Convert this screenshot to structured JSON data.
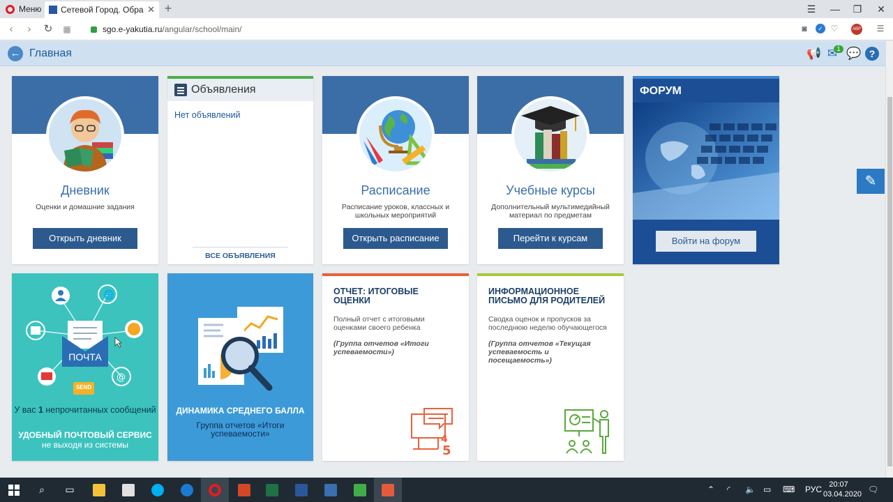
{
  "browser": {
    "menu_label": "Меню",
    "tab_title": "Сетевой Город. Образова",
    "url_host": "sgo.e-yakutia.ru",
    "url_path": "/angular/school/main/"
  },
  "header": {
    "title": "Главная",
    "messages_badge": "1"
  },
  "cards": {
    "diary": {
      "title": "Дневник",
      "desc": "Оценки и домашние задания",
      "button": "Открыть дневник"
    },
    "announcements": {
      "title": "Объявления",
      "empty": "Нет объявлений",
      "all_link": "ВСЕ ОБЪЯВЛЕНИЯ"
    },
    "schedule": {
      "title": "Расписание",
      "desc": "Расписание уроков, классных и школьных мероприятий",
      "button": "Открыть расписание"
    },
    "courses": {
      "title": "Учебные курсы",
      "desc": "Дополнительный мультимедийный материал по предметам",
      "button": "Перейти к курсам"
    },
    "forum": {
      "title": "ФОРУМ",
      "button": "Войти на форум"
    },
    "mail": {
      "envelope_label": "ПОЧТА",
      "send_label": "SEND",
      "unread_prefix": "У вас",
      "unread_count": "1",
      "unread_suffix": "непрочитанных сообщений",
      "service_title": "УДОБНЫЙ ПОЧТОВЫЙ СЕРВИС",
      "service_sub": "не выходя из системы"
    },
    "dynamics": {
      "title": "ДИНАМИКА СРЕДНЕГО БАЛЛА",
      "group": "Группа отчетов «Итоги успеваемости»"
    },
    "report_grades": {
      "title": "ОТЧЕТ: ИТОГОВЫЕ ОЦЕНКИ",
      "desc": "Полный отчет с итоговыми оценками своего ребенка",
      "group": "(Группа отчетов «Итоги успеваемости»)",
      "icon_grade_a": "4",
      "icon_grade_b": "5"
    },
    "report_letter": {
      "title": "ИНФОРМАЦИОННОЕ ПИСЬМО ДЛЯ РОДИТЕЛЕЙ",
      "desc": "Сводка оценок и пропусков за последнюю неделю обучающегося",
      "group": "(Группа отчетов «Текущая успеваемость и посещаемость»)"
    }
  },
  "taskbar": {
    "language": "РУС",
    "time": "20:07",
    "date": "03.04.2020"
  },
  "colors": {
    "card_header": "#3b6ea7",
    "button": "#2c5a8f",
    "forum_bg": "#1c4e96",
    "mail_bg": "#3cc3bd",
    "dynamics_bg": "#3d9ad8",
    "report_accent": "#e8623c",
    "letter_accent": "#a8c83c",
    "announce_accent": "#4cae4c"
  }
}
